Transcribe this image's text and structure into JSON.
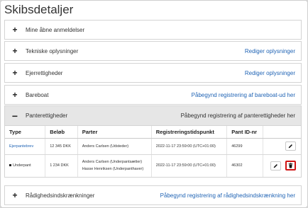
{
  "page": {
    "title": "Skibsdetaljer"
  },
  "sections": [
    {
      "title": "Mine åbne anmeldelser",
      "action": ""
    },
    {
      "title": "Tekniske oplysninger",
      "action": "Rediger oplysninger"
    },
    {
      "title": "Ejerrettigheder",
      "action": "Rediger oplysninger"
    },
    {
      "title": "Bareboat",
      "action": "Påbegynd registrering af bareboat-ud her"
    },
    {
      "title": "Panterettigheder",
      "action": "Påbegynd registrering af panterettigheder her"
    },
    {
      "title": "Rådighedsindskrænkninger",
      "action": "Påbegynd registrering af rådighedsindskrænkning her"
    }
  ],
  "mortgage_table": {
    "columns": [
      "Type",
      "Beløb",
      "Parter",
      "Registreringstidspunkt",
      "Pant ID-nr"
    ],
    "rows": [
      {
        "type": "Ejerpantebrev",
        "amount": "12 345 DKK",
        "parties": [
          "Anders Carlsen (Udsteder)"
        ],
        "registered": "2022-11-17 23:59:00 (UTC+01:00)",
        "pant_id": "46299"
      },
      {
        "type": "Underpant",
        "amount": "1 234 DKK",
        "parties": [
          "Anders Carlsen (Underpantsætter)",
          "Hasse Henriksen (Underpanthaver)"
        ],
        "registered": "2022-11-17 23:59:00 (UTC+01:00)",
        "pant_id": "46302"
      }
    ]
  },
  "icons": {
    "expand": "plus-icon",
    "collapse": "minus-icon",
    "edit": "pencil-icon",
    "delete": "trash-icon"
  },
  "colors": {
    "link": "#1f63b4",
    "danger": "#d01414",
    "header_bg": "#e6e6e6"
  }
}
